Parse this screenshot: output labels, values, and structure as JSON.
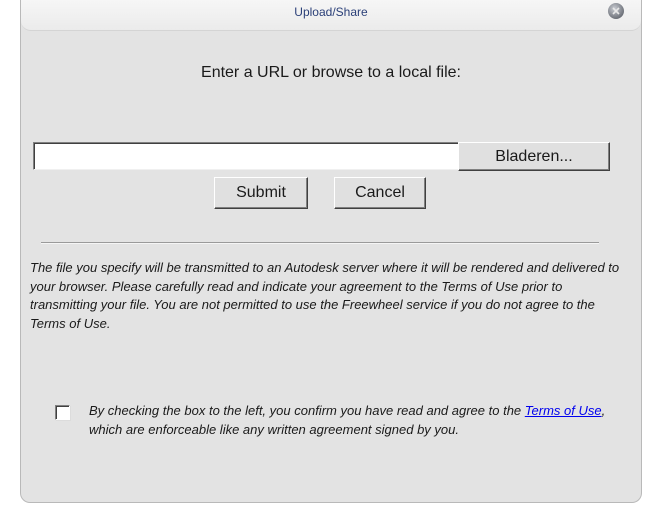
{
  "dialog": {
    "title": "Upload/Share",
    "close_icon": "close-icon"
  },
  "form": {
    "prompt": "Enter a URL or browse to a local file:",
    "url_value": "",
    "url_placeholder": "",
    "browse_label": "Bladeren...",
    "submit_label": "Submit",
    "cancel_label": "Cancel"
  },
  "info": {
    "text": "The file you specify will be transmitted to an Autodesk server where it will be rendered and delivered to your browser. Please carefully read and indicate your agreement to the Terms of Use prior to transmitting your file. You are not permitted to use the Freewheel service if you do not agree to the Terms of Use."
  },
  "agreement": {
    "checked": false,
    "text_before": "By checking the box to the left, you confirm you have read and agree to the ",
    "link_text": "Terms of Use",
    "text_after": ", which are enforceable like any written agreement signed by you."
  },
  "colors": {
    "title": "#2a3f78",
    "link": "#0000ee",
    "panel": "#e3e3e3"
  }
}
